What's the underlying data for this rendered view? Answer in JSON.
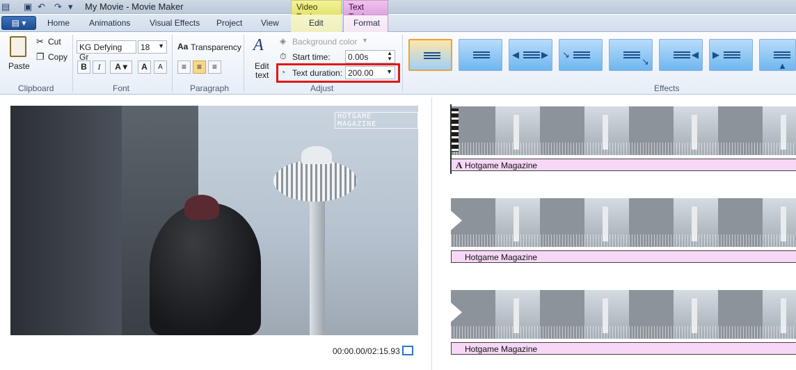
{
  "titlebar": {
    "title": "My Movie - Movie Maker",
    "contextual_groups": {
      "video_tools": "Video Tools",
      "text_tools": "Text Tools"
    }
  },
  "tabs": {
    "home": "Home",
    "animations": "Animations",
    "visual_effects": "Visual Effects",
    "project": "Project",
    "view": "View",
    "edit": "Edit",
    "format": "Format"
  },
  "ribbon": {
    "clipboard": {
      "label": "Clipboard",
      "paste": "Paste",
      "cut": "Cut",
      "copy": "Copy"
    },
    "font": {
      "label": "Font",
      "family": "KG Defying Gr",
      "size": "18",
      "transparency": "Transparency",
      "bold": "B",
      "italic": "I",
      "color": "A",
      "grow": "A",
      "shrink": "A"
    },
    "paragraph": {
      "label": "Paragraph"
    },
    "adjust": {
      "label": "Adjust",
      "edit_text": [
        "Edit",
        "text"
      ],
      "background_color": "Background color",
      "start_time_label": "Start time:",
      "start_time_value": "0.00s",
      "text_duration_label": "Text duration:",
      "text_duration_value": "200.00"
    },
    "effects": {
      "label": "Effects"
    }
  },
  "preview": {
    "watermark": "HOTGAME MAGAZINE",
    "timecode": "00:00.00/02:15.93"
  },
  "storyboard": {
    "captions": [
      "Hotgame Magazine",
      "Hotgame Magazine",
      "Hotgame Magazine"
    ]
  },
  "colors": {
    "highlight_box": "#e01818",
    "caption_bar": "#f6d8f6",
    "text_tools_tab": "#dfa5df",
    "video_tools_tab": "#e3e36e"
  }
}
